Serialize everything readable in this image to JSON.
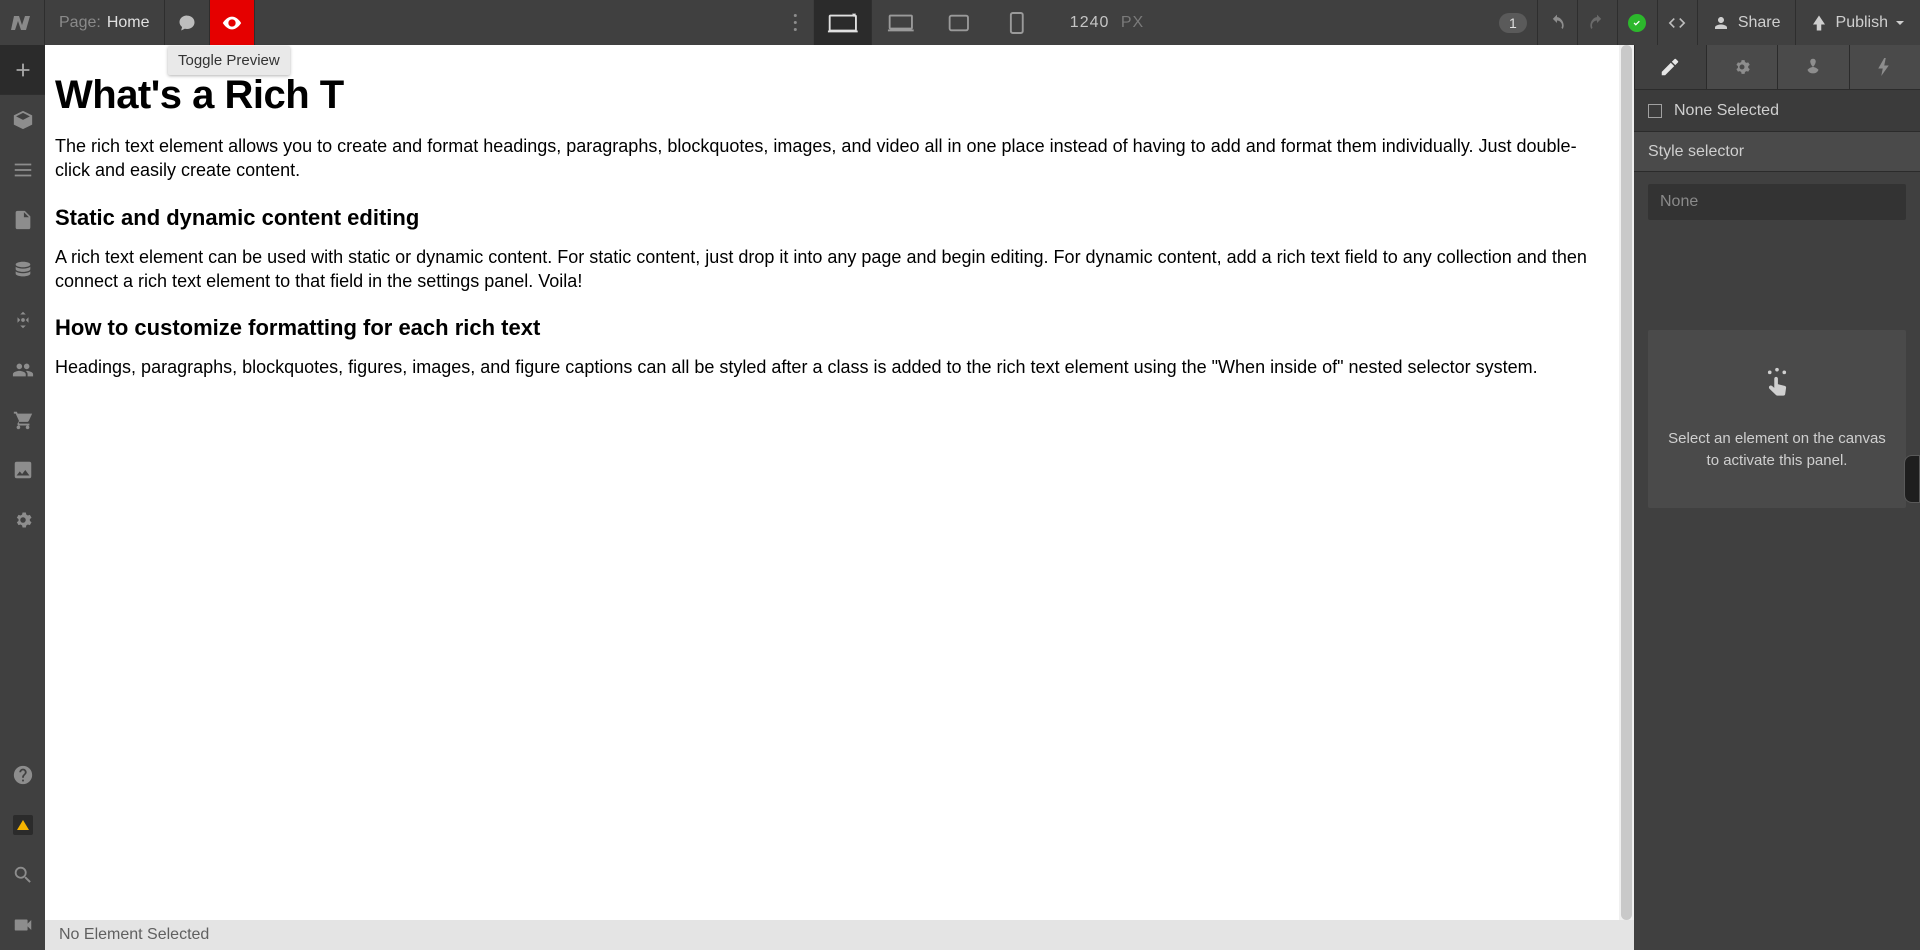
{
  "topbar": {
    "page_label": "Page:",
    "page_name": "Home",
    "tooltip_preview": "Toggle Preview",
    "viewport_value": "1240",
    "viewport_unit": "PX",
    "badge_count": "1",
    "share_label": "Share",
    "publish_label": "Publish"
  },
  "canvas": {
    "h1": "What's a Rich T",
    "p1": "The rich text element allows you to create and format headings, paragraphs, blockquotes, images, and video all in one place instead of having to add and format them individually. Just double-click and easily create content.",
    "h3a": "Static and dynamic content editing",
    "p2": "A rich text element can be used with static or dynamic content. For static content, just drop it into any page and begin editing. For dynamic content, add a rich text field to any collection and then connect a rich text element to that field in the settings panel. Voila!",
    "h3b": "How to customize formatting for each rich text",
    "p3": "Headings, paragraphs, blockquotes, figures, images, and figure captions can all be styled after a class is added to the rich text element using the \"When inside of\" nested selector system."
  },
  "statusbar": {
    "text": "No Element Selected"
  },
  "rightpanel": {
    "none_selected": "None Selected",
    "style_selector_label": "Style selector",
    "selector_placeholder": "None",
    "empty_hint_line1": "Select an element on the canvas",
    "empty_hint_line2": "to activate this panel."
  }
}
